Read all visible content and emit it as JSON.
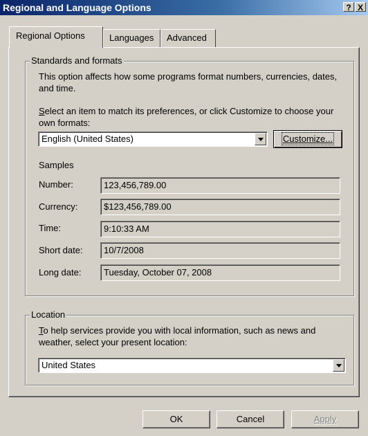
{
  "window": {
    "title": "Regional and Language Options",
    "help_label": "?",
    "close_label": "X"
  },
  "tabs": [
    {
      "label": "Regional Options"
    },
    {
      "label": "Languages"
    },
    {
      "label": "Advanced"
    }
  ],
  "standards": {
    "group_label": "Standards and formats",
    "description": "This option affects how some programs format numbers, currencies, dates, and time.",
    "select_prompt_hotkey": "S",
    "select_prompt_rest": "elect an item to match its preferences, or click Customize to choose your own formats:",
    "format_value": "English (United States)",
    "customize_hotkey": "Customize...",
    "samples_label": "Samples",
    "samples": [
      {
        "label": "Number:",
        "value": "123,456,789.00"
      },
      {
        "label": "Currency:",
        "value": "$123,456,789.00"
      },
      {
        "label": "Time:",
        "value": "9:10:33 AM"
      },
      {
        "label": "Short date:",
        "value": "10/7/2008"
      },
      {
        "label": "Long date:",
        "value": "Tuesday, October 07, 2008"
      }
    ]
  },
  "location": {
    "group_label": "Location",
    "description_hotkey": "T",
    "description_rest": "o help services provide you with local information, such as news and weather, select your present location:",
    "value": "United States"
  },
  "buttons": {
    "ok": "OK",
    "cancel": "Cancel",
    "apply": "Apply"
  },
  "colors": {
    "title_start": "#0a246a",
    "title_end": "#a6caf0",
    "face": "#d4d0c8",
    "disabled_text": "#808080"
  }
}
